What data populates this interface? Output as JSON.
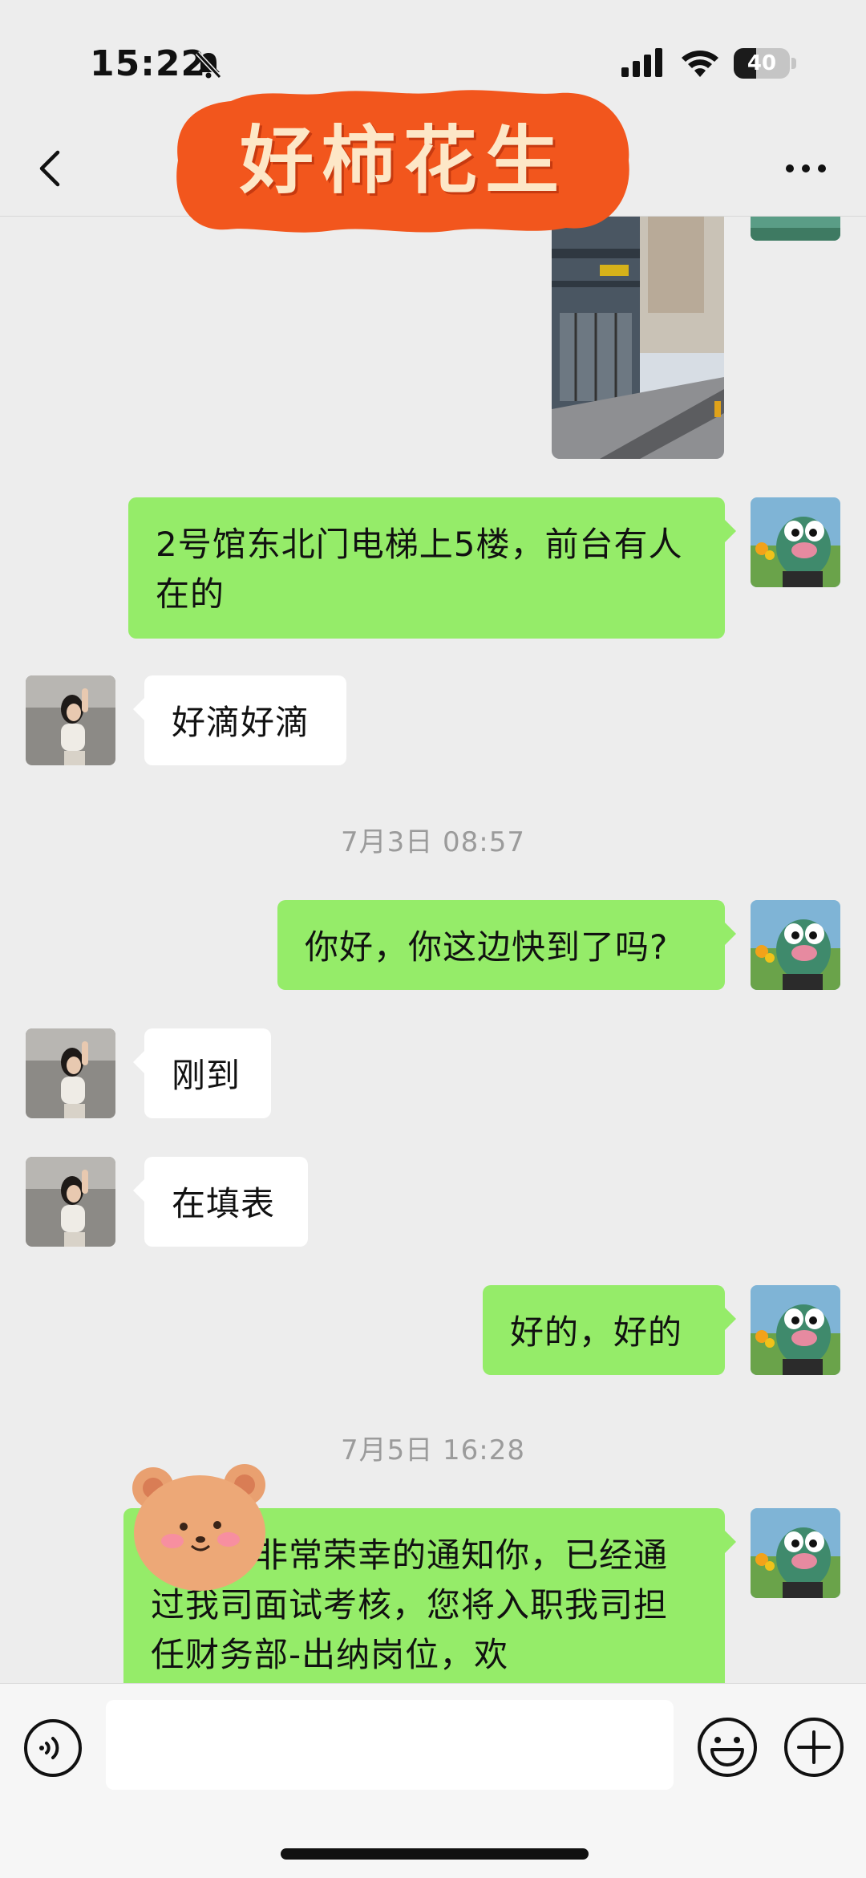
{
  "status_bar": {
    "time": "15:22",
    "battery": "40",
    "battery_level": 0.4
  },
  "nav": {
    "title": "好柿花生"
  },
  "chat": {
    "messages": [
      {
        "side": "me",
        "text": "2号馆东北门电梯上5楼，前台有人在的"
      },
      {
        "side": "them",
        "text": "好滴好滴"
      },
      {
        "type": "timestamp",
        "text": "7月3日 08:57"
      },
      {
        "side": "me",
        "text": "你好，你这边快到了吗?"
      },
      {
        "side": "them",
        "text": "刚到"
      },
      {
        "side": "them",
        "text": "在填表"
      },
      {
        "side": "me",
        "text": "好的，好的"
      },
      {
        "type": "timestamp",
        "text": "7月5日 16:28"
      },
      {
        "side": "me",
        "text": "您好：非常荣幸的通知你，已经通过我司面试考核，您将入职我司担任财务部-出纳岗位，欢"
      }
    ]
  },
  "colors": {
    "me_bubble": "#95ec69",
    "them_bubble": "#ffffff",
    "background": "#ededed",
    "sticker": "#f2561d"
  },
  "icons": {
    "voice": "voice-icon",
    "emoji": "emoji-icon",
    "plus": "plus-icon",
    "back": "back-icon",
    "more": "more-icon"
  }
}
